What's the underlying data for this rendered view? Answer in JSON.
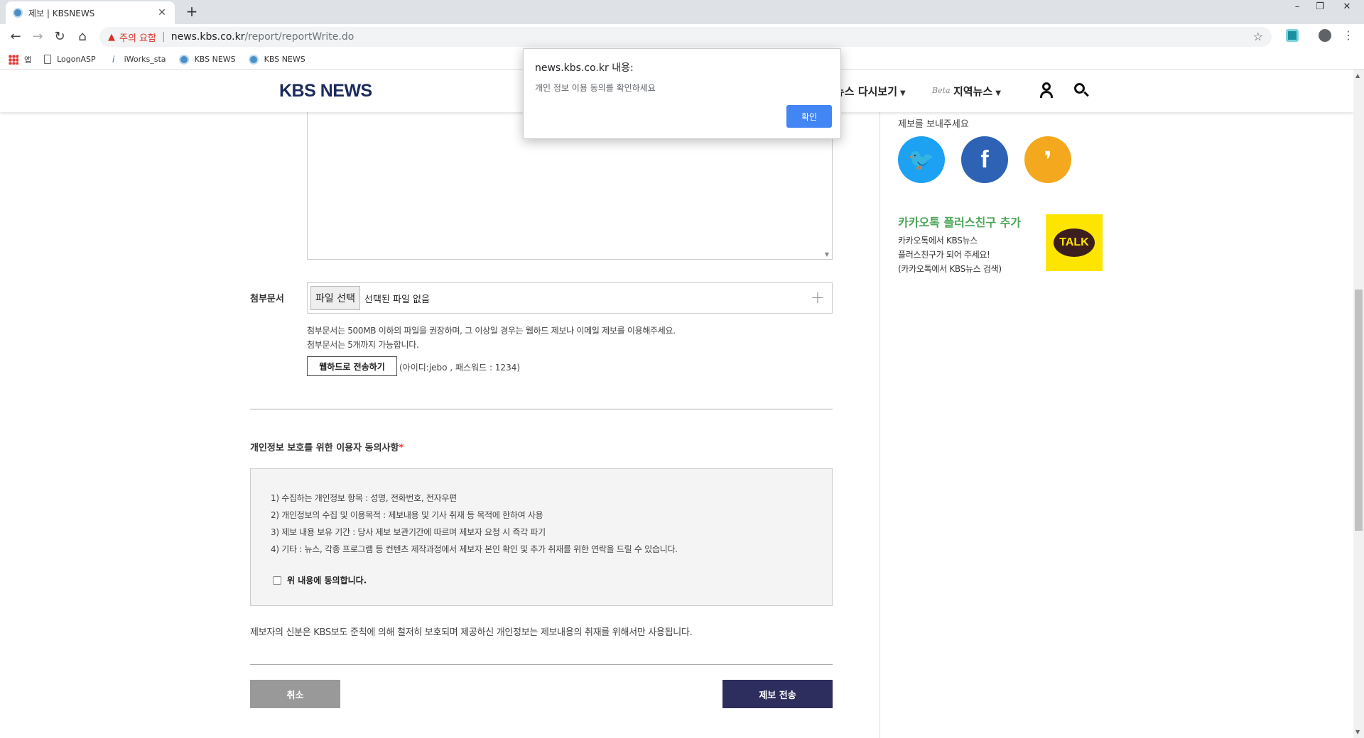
{
  "browser": {
    "tab_title": "제보 | KBSNEWS",
    "tab_close": "✕",
    "new_tab": "+",
    "window_controls": {
      "minimize": "–",
      "restore": "❐",
      "close": "✕"
    },
    "security_warning": "주의 요함",
    "url_host": "news.kbs.co.kr",
    "url_path": "/report/reportWrite.do",
    "bookmarks": [
      {
        "label": "앱",
        "icon": "apps-grid-icon"
      },
      {
        "label": "LogonASP",
        "icon": "page-icon"
      },
      {
        "label": "iWorks_sta",
        "icon": "iworks-icon"
      },
      {
        "label": "KBS NEWS",
        "icon": "kbs-icon"
      },
      {
        "label": "KBS NEWS",
        "icon": "kbs-icon"
      }
    ]
  },
  "header": {
    "logo": "KBS NEWS",
    "menu_replay": "뉴스 다시보기",
    "menu_beta": "Beta",
    "menu_local": "지역뉴스",
    "caret": "▼"
  },
  "form": {
    "attachment_label": "첨부문서",
    "file_button": "파일 선택",
    "file_none": "선택된 파일 없음",
    "file_plus": "+",
    "note_line1": "첨부문서는 500MB 이하의 파일을 권장하며, 그 이상일 경우는 웹하드 제보나 이메일 제보를 이용해주세요.",
    "note_line2": "첨부문서는 5개까지 가능합니다.",
    "webhard_button": "웹하드로 전송하기",
    "webhard_info": "(아이디:jebo , 패스워드 : 1234)",
    "consent_title": "개인정보 보호를 위한 이용자 동의사항",
    "required_mark": "*",
    "consent_items": [
      "1) 수집하는 개인정보 항목 : 성명, 전화번호, 전자우편",
      "2) 개인정보의 수집 및 이용목적 : 제보내용 및 기사 취재 등 목적에 한하여 사용",
      "3) 제보 내용 보유 기간 : 당사 제보 보관기간에 따르며 제보자 요청 시 즉각 파기",
      "4) 기타 : 뉴스, 각종 프로그램 등 컨텐츠 제작과정에서 제보자 본인 확인 및 추가 취재를 위한 연락을 드릴 수 있습니다."
    ],
    "agree_label": "위 내용에 동의합니다.",
    "privacy_note": "제보자의 신분은 KBS보도 준칙에 의해 철저히 보호되며 제공하신 개인정보는 제보내용의 취재를 위해서만 사용됩니다.",
    "cancel_button": "취소",
    "submit_button": "제보 전송"
  },
  "sidebar": {
    "sns_text": "제보를 보내주세요",
    "twitter_glyph": "🐦",
    "facebook_glyph": "f",
    "kakaostory_glyph": "❜",
    "kakao_title": "카카오톡 플러스친구 추가",
    "kakao_desc": [
      "카카오톡에서 KBS뉴스",
      "플러스친구가 되어 주세요!",
      "(카카오톡에서 KBS뉴스 검색)"
    ],
    "talk_badge": "TALK"
  },
  "alert": {
    "title": "news.kbs.co.kr 내용:",
    "message": "개인 정보 이용 동의를 확인하세요",
    "ok_button": "확인"
  }
}
